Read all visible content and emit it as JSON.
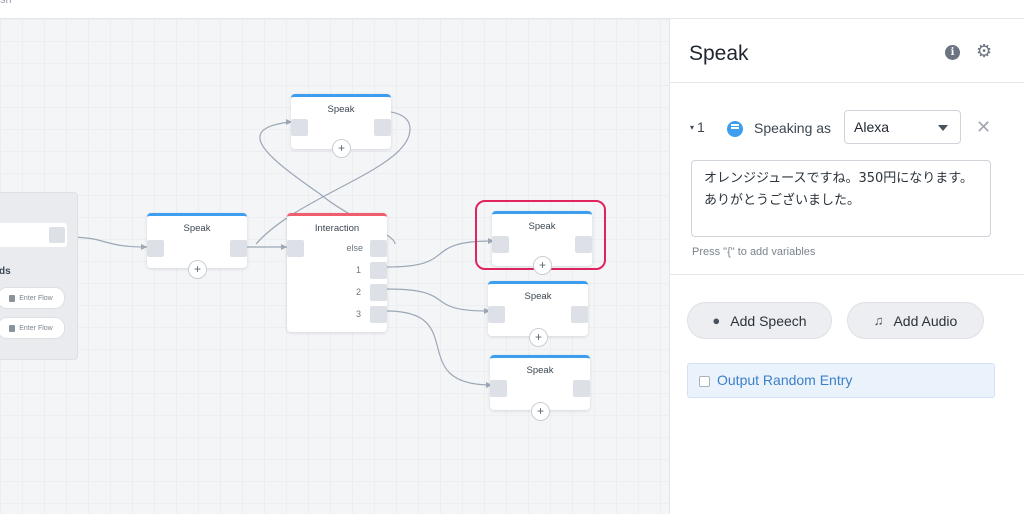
{
  "canvas": {
    "group": {
      "label": "ds",
      "flow_buttons": [
        "Enter Flow",
        "Enter Flow"
      ]
    },
    "nodes": {
      "speak_top": "Speak",
      "speak_left": "Speak",
      "speak_selected": "Speak",
      "speak_mid": "Speak",
      "speak_bottom": "Speak",
      "interaction": {
        "title": "Interaction",
        "choices": [
          "else",
          "1",
          "2",
          "3"
        ]
      }
    },
    "plus_symbol": "+"
  },
  "panel": {
    "title": "Speak",
    "info_icon": "i",
    "settings_icon": "⚙",
    "entry": {
      "index": "1",
      "collapse_icon": "▾",
      "speaking_as_label": "Speaking as",
      "voice": "Alexa",
      "remove_icon": "✕",
      "speech_text": "オレンジジュースですね。350円になります。ありがとうございました。"
    },
    "hint": "Press \"{\" to add variables",
    "add_speech": "Add Speech",
    "add_audio": "Add Audio",
    "random_entry": "Output Random Entry"
  },
  "colors": {
    "accent_blue": "#3d9ef0",
    "interaction_red": "#f05d6c",
    "selection_pink": "#e0245e"
  }
}
